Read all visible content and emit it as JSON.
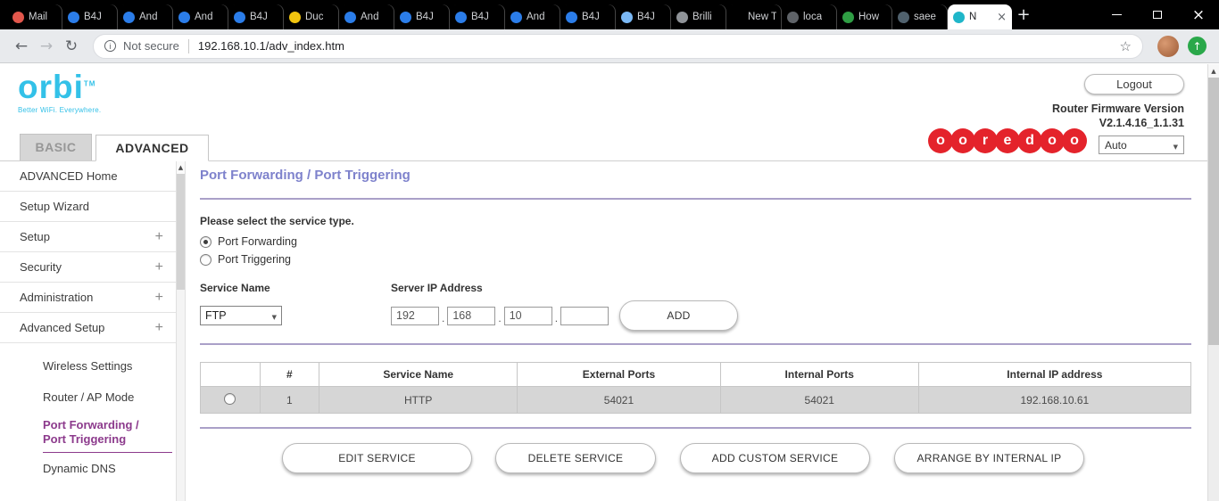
{
  "browser": {
    "tabs": [
      {
        "label": "Mail",
        "icon_color": "#e2574c"
      },
      {
        "label": "B4J",
        "icon_color": "#2b7de9"
      },
      {
        "label": "And",
        "icon_color": "#2b7de9"
      },
      {
        "label": "And",
        "icon_color": "#2b7de9"
      },
      {
        "label": "B4J",
        "icon_color": "#2b7de9"
      },
      {
        "label": "Duc",
        "icon_color": "#f2c50f"
      },
      {
        "label": "And",
        "icon_color": "#2b7de9"
      },
      {
        "label": "B4J",
        "icon_color": "#2b7de9"
      },
      {
        "label": "B4J",
        "icon_color": "#2b7de9"
      },
      {
        "label": "And",
        "icon_color": "#2b7de9"
      },
      {
        "label": "B4J",
        "icon_color": "#2b7de9"
      },
      {
        "label": "B4J",
        "icon_color": "#7ab8f5"
      },
      {
        "label": "Brilli",
        "icon_color": "#8f9398"
      },
      {
        "label": "New Tab"
      },
      {
        "label": "loca",
        "icon_color": "#5f6368"
      },
      {
        "label": "How",
        "icon_color": "#2f9e44"
      },
      {
        "label": "saee",
        "icon_color": "#50616d"
      },
      {
        "label": "N",
        "icon_color": "#1fb6c9",
        "active": true
      }
    ],
    "new_tab_label": "+",
    "close_tab_label": "×",
    "nav": {
      "back": "←",
      "forward": "→",
      "reload": "↻",
      "star": "☆"
    },
    "address_bar": {
      "security": "Not secure",
      "url": "192.168.10.1/adv_index.htm"
    }
  },
  "header": {
    "logo_text": "orbi",
    "logo_tm": "TM",
    "tagline": "Better WiFi. Everywhere.",
    "logout": "Logout",
    "firmware_label": "Router Firmware Version",
    "firmware_version": "V2.1.4.16_1.1.31",
    "brand_color": "#e4232b",
    "brand_letters": [
      "o",
      "o",
      "r",
      "e",
      "d",
      "o",
      "o"
    ],
    "nav_tabs": {
      "basic": "BASIC",
      "advanced": "ADVANCED"
    },
    "language": "Auto"
  },
  "sidebar": {
    "expand_icon": "+",
    "items": [
      {
        "label": "ADVANCED Home",
        "expandable": false
      },
      {
        "label": "Setup Wizard",
        "expandable": false
      },
      {
        "label": "Setup",
        "expandable": true
      },
      {
        "label": "Security",
        "expandable": true
      },
      {
        "label": "Administration",
        "expandable": true
      },
      {
        "label": "Advanced Setup",
        "expandable": true
      }
    ],
    "sub_items": [
      {
        "label": "Wireless Settings",
        "active": false
      },
      {
        "label": "Router / AP Mode",
        "active": false
      },
      {
        "label": "Port Forwarding / Port Triggering",
        "active": true
      },
      {
        "label": "Dynamic DNS",
        "active": false
      }
    ]
  },
  "main": {
    "title": "Port Forwarding / Port Triggering",
    "service_type_label": "Please select the service type.",
    "radios": [
      {
        "label": "Port Forwarding",
        "selected": true
      },
      {
        "label": "Port Triggering",
        "selected": false
      }
    ],
    "service_name_label": "Service Name",
    "service_name_value": "FTP",
    "server_ip_label": "Server IP Address",
    "ip_octets": [
      "192",
      "168",
      "10",
      ""
    ],
    "ip_separator": ".",
    "add_button": "ADD",
    "table": {
      "headers": [
        "",
        "#",
        "Service Name",
        "External Ports",
        "Internal Ports",
        "Internal IP address"
      ],
      "rows": [
        {
          "num": "1",
          "service_name": "HTTP",
          "external_ports": "54021",
          "internal_ports": "54021",
          "internal_ip": "192.168.10.61"
        }
      ]
    },
    "actions": [
      "EDIT SERVICE",
      "DELETE SERVICE",
      "ADD CUSTOM SERVICE",
      "ARRANGE BY INTERNAL IP"
    ]
  }
}
